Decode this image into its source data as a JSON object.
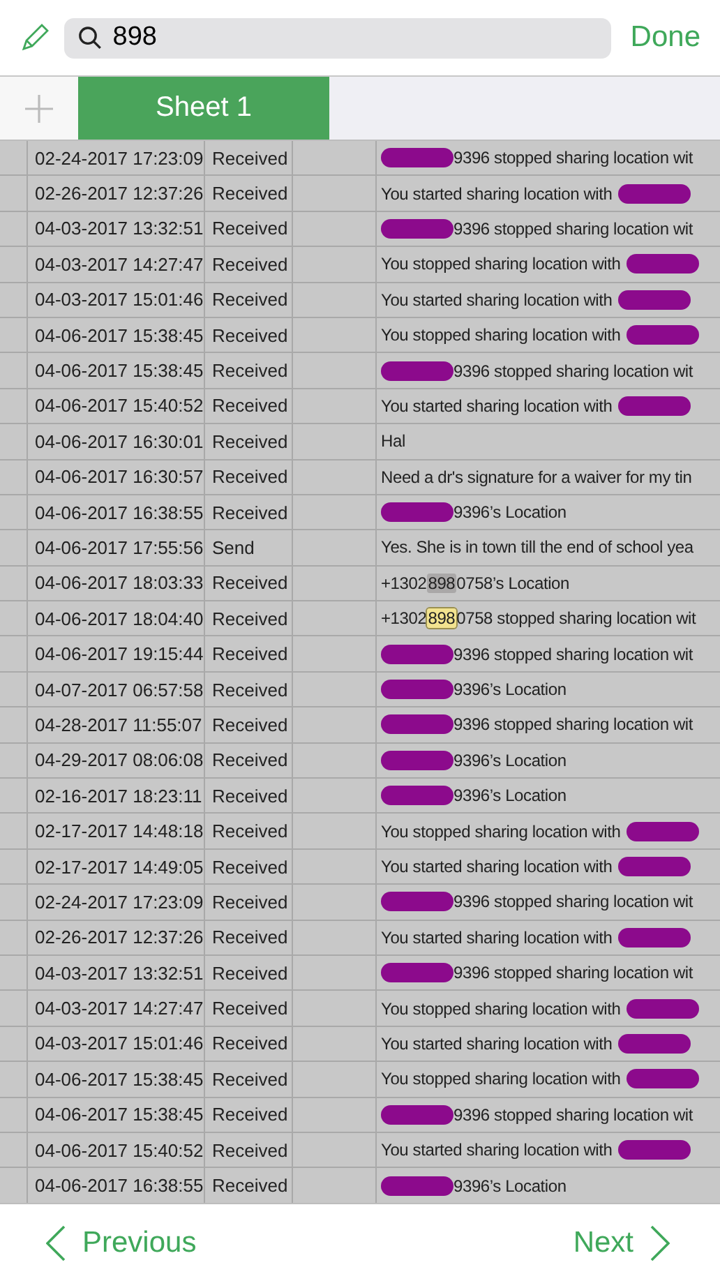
{
  "toolbar": {
    "search": {
      "value": "898"
    },
    "done": "Done"
  },
  "tabs": [
    {
      "label": "Sheet 1",
      "selected": true
    }
  ],
  "rows": [
    {
      "date": "02-24-2017 17:23:09",
      "type": "Received",
      "redacted_before": true,
      "message": "9396 stopped sharing location wit"
    },
    {
      "date": "02-26-2017 12:37:26",
      "type": "Received",
      "redacted_after": true,
      "message": "You started sharing location with"
    },
    {
      "date": "04-03-2017 13:32:51",
      "type": "Received",
      "redacted_before": true,
      "message": "9396 stopped sharing location wit"
    },
    {
      "date": "04-03-2017 14:27:47",
      "type": "Received",
      "redacted_after": true,
      "message": "You stopped sharing location with"
    },
    {
      "date": "04-03-2017 15:01:46",
      "type": "Received",
      "redacted_after": true,
      "message": "You started sharing location with"
    },
    {
      "date": "04-06-2017 15:38:45",
      "type": "Received",
      "redacted_after": true,
      "message": "You stopped sharing location with"
    },
    {
      "date": "04-06-2017 15:38:45",
      "type": "Received",
      "redacted_before": true,
      "message": "9396 stopped sharing location wit"
    },
    {
      "date": "04-06-2017 15:40:52",
      "type": "Received",
      "redacted_after": true,
      "message": "You started sharing location with"
    },
    {
      "date": "04-06-2017 16:30:01",
      "type": "Received",
      "message": "Hal"
    },
    {
      "date": "04-06-2017 16:30:57",
      "type": "Received",
      "message": "Need a dr's signature for a waiver for my tin"
    },
    {
      "date": "04-06-2017 16:38:55",
      "type": "Received",
      "redacted_before": true,
      "message": "9396’s Location"
    },
    {
      "date": "04-06-2017 17:55:56",
      "type": "Send",
      "message": "Yes. She is in town till the end of school yea"
    },
    {
      "date": "04-06-2017 18:03:33",
      "type": "Received",
      "message": "+1302",
      "match": "898",
      "after": "0758’s Location",
      "current": false
    },
    {
      "date": "04-06-2017 18:04:40",
      "type": "Received",
      "message": "+1302",
      "match": "898",
      "after": "0758 stopped sharing location wit",
      "current": true
    },
    {
      "date": "04-06-2017 19:15:44",
      "type": "Received",
      "redacted_before": true,
      "message": "9396 stopped sharing location wit"
    },
    {
      "date": "04-07-2017 06:57:58",
      "type": "Received",
      "redacted_before": true,
      "message": "9396’s Location"
    },
    {
      "date": "04-28-2017 11:55:07",
      "type": "Received",
      "redacted_before": true,
      "message": "9396 stopped sharing location wit"
    },
    {
      "date": "04-29-2017 08:06:08",
      "type": "Received",
      "redacted_before": true,
      "message": "9396’s Location"
    },
    {
      "date": "02-16-2017 18:23:11",
      "type": "Received",
      "redacted_before": true,
      "message": "9396’s Location"
    },
    {
      "date": "02-17-2017 14:48:18",
      "type": "Received",
      "redacted_after": true,
      "message": "You stopped sharing location with"
    },
    {
      "date": "02-17-2017 14:49:05",
      "type": "Received",
      "redacted_after": true,
      "message": "You started sharing location with"
    },
    {
      "date": "02-24-2017 17:23:09",
      "type": "Received",
      "redacted_before": true,
      "message": "9396 stopped sharing location wit"
    },
    {
      "date": "02-26-2017 12:37:26",
      "type": "Received",
      "redacted_after": true,
      "message": "You started sharing location with"
    },
    {
      "date": "04-03-2017 13:32:51",
      "type": "Received",
      "redacted_before": true,
      "message": "9396 stopped sharing location wit"
    },
    {
      "date": "04-03-2017 14:27:47",
      "type": "Received",
      "redacted_after": true,
      "message": "You stopped sharing location with"
    },
    {
      "date": "04-03-2017 15:01:46",
      "type": "Received",
      "redacted_after": true,
      "message": "You started sharing location with"
    },
    {
      "date": "04-06-2017 15:38:45",
      "type": "Received",
      "redacted_after": true,
      "message": "You stopped sharing location with"
    },
    {
      "date": "04-06-2017 15:38:45",
      "type": "Received",
      "redacted_before": true,
      "message": "9396 stopped sharing location wit"
    },
    {
      "date": "04-06-2017 15:40:52",
      "type": "Received",
      "redacted_after": true,
      "message": "You started sharing location with"
    },
    {
      "date": "04-06-2017 16:38:55",
      "type": "Received",
      "redacted_before": true,
      "message": "9396’s Location"
    }
  ],
  "footer": {
    "previous": "Previous",
    "next": "Next"
  }
}
